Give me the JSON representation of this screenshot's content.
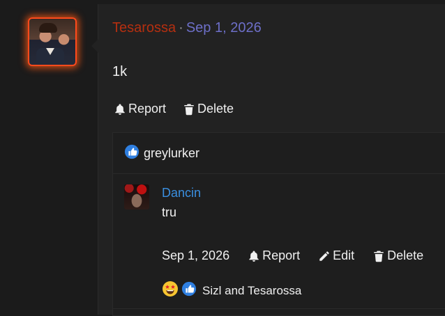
{
  "post": {
    "author": "Tesarossa",
    "separator": "·",
    "date": "Sep 1, 2026",
    "text": "1k",
    "actions": {
      "report": "Report",
      "delete": "Delete"
    }
  },
  "likes": {
    "liker": "greylurker"
  },
  "comment": {
    "author": "Dancin",
    "text": "tru",
    "date": "Sep 1, 2026",
    "actions": {
      "report": "Report",
      "edit": "Edit",
      "delete": "Delete"
    },
    "reactions_text": "Sizl and Tesarossa"
  },
  "colors": {
    "author": "#b52f10",
    "date": "#6d6fc8",
    "link": "#3a8fe0",
    "like_badge": "#2f7fe0",
    "avatar_glow": "#ff4a1c"
  },
  "icons": [
    "bell-icon",
    "trash-icon",
    "pencil-icon",
    "thumbs-up-icon",
    "star-eyes-emoji-icon"
  ]
}
